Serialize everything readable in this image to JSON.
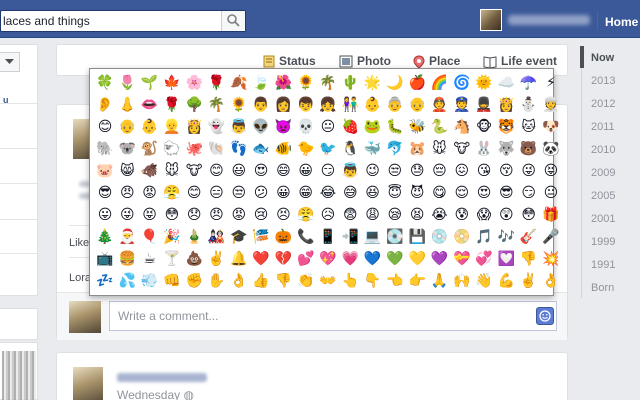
{
  "topbar": {
    "search_value": "laces and things",
    "home_label": "Home"
  },
  "left": {
    "snippet": "u"
  },
  "composer": {
    "tabs": [
      {
        "label": "Status",
        "icon": "status-icon"
      },
      {
        "label": "Photo",
        "icon": "photo-icon"
      },
      {
        "label": "Place",
        "icon": "place-pin-icon"
      },
      {
        "label": "Life event",
        "icon": "life-event-icon"
      }
    ]
  },
  "story": {
    "like_snippet": "Like",
    "lora_snippet": "Lora",
    "comment_placeholder": "Write a comment...",
    "time_label": "Wednesday"
  },
  "emoji_picker": {
    "rows": [
      [
        "🍀",
        "🌷",
        "🌱",
        "🍁",
        "🌸",
        "🌹",
        "🍂",
        "🍃",
        "🌺",
        "🌻",
        "🌴",
        "🌵",
        "🌟",
        "🌙",
        "🍎",
        "🌈",
        "🌀",
        "🌞",
        "☁️",
        "☂️",
        "⚡"
      ],
      [
        "👂",
        "👃",
        "👄",
        "🌹",
        "🌳",
        "🌴",
        "🌻",
        "👨",
        "👩",
        "👦",
        "👧",
        "👫",
        "👶",
        "👵",
        "👴",
        "👲",
        "👮",
        "💂",
        "👸",
        "⛄",
        "👳"
      ],
      [
        "😊",
        "👴",
        "👶",
        "👱",
        "👸",
        "👻",
        "👼",
        "👽",
        "👿",
        "💀",
        "😐",
        "🍓",
        "🐸",
        "🐛",
        "🐝",
        "🐍",
        "🐴",
        "🐵",
        "🐯",
        "🐱",
        "🐶"
      ],
      [
        "🐘",
        "🐨",
        "🐒",
        "🐑",
        "🐙",
        "🐚",
        "👣",
        "🐟",
        "🐠",
        "🐤",
        "🐦",
        "🐧",
        "🐳",
        "🐬",
        "🐹",
        "🐭",
        "🐮",
        "🐰",
        "🐺",
        "🐻",
        "🐼"
      ],
      [
        "🐷",
        "😸",
        "🐗",
        "🐭",
        "🐮",
        "😊",
        "😃",
        "😍",
        "😄",
        "😀",
        "😏",
        "👼",
        "😉",
        "😒",
        "😓",
        "😔",
        "😖",
        "😘",
        "😚",
        "😜",
        "😝"
      ],
      [
        "😎",
        "😠",
        "😡",
        "😤",
        "😊",
        "😑",
        "😒",
        "😕",
        "😀",
        "😁",
        "😂",
        "😅",
        "😆",
        "😇",
        "😈",
        "😋",
        "😌",
        "😍",
        "😎",
        "😏",
        "😐"
      ],
      [
        "😛",
        "😜",
        "😝",
        "😳",
        "😞",
        "😠",
        "😡",
        "😢",
        "😣",
        "😤",
        "😥",
        "😨",
        "😩",
        "😪",
        "😫",
        "😭",
        "😰",
        "😱",
        "😲",
        "😳",
        "🎁"
      ],
      [
        "🎄",
        "🎅",
        "🎈",
        "🎉",
        "🎍",
        "🎎",
        "🎓",
        "🎏",
        "🎃",
        "📞",
        "📱",
        "📲",
        "💻",
        "💽",
        "💾",
        "💿",
        "📀",
        "🎵",
        "🎶",
        "🎸",
        "🎤"
      ],
      [
        "📺",
        "🍔",
        "☕",
        "🍸",
        "💩",
        "✌️",
        "🔔",
        "❤️",
        "💔",
        "💕",
        "💖",
        "💗",
        "💙",
        "💚",
        "💛",
        "💜",
        "💝",
        "💞",
        "💟",
        "👎",
        "💥"
      ],
      [
        "💤",
        "💦",
        "💨",
        "👊",
        "✊",
        "✋",
        "👌",
        "👍",
        "👎",
        "👏",
        "👐",
        "👆",
        "👇",
        "👈",
        "👉",
        "🙏",
        "🙌",
        "👋",
        "💪",
        "✌️",
        "👌"
      ]
    ]
  },
  "timeline": {
    "items": [
      "Now",
      "2013",
      "2012",
      "2011",
      "2010",
      "2009",
      "2005",
      "2001",
      "1999",
      "1991",
      "Born"
    ]
  }
}
